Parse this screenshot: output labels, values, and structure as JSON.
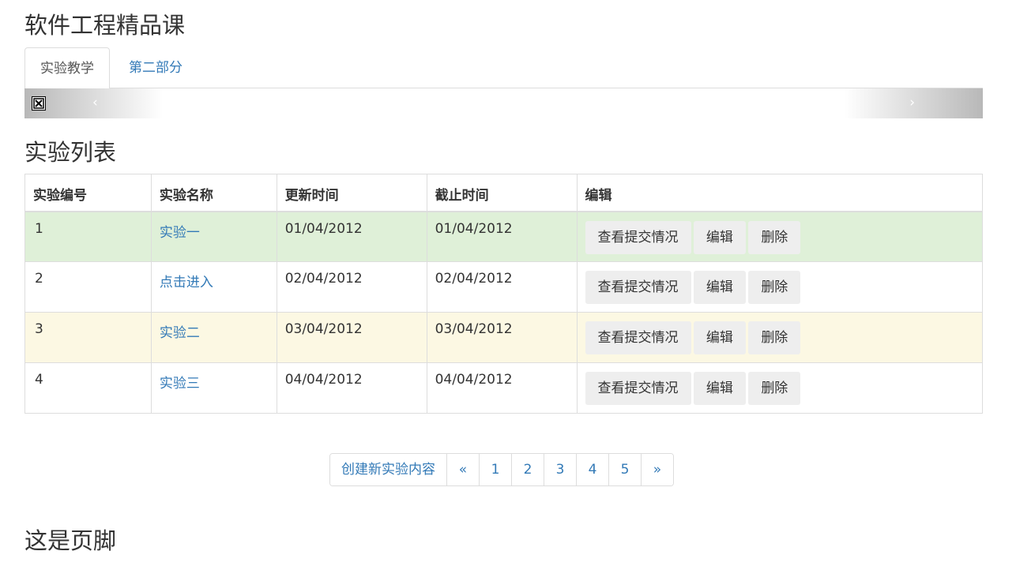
{
  "header": {
    "title": "软件工程精品课"
  },
  "tabs": [
    {
      "label": "实验教学",
      "active": true
    },
    {
      "label": "第二部分",
      "active": false
    }
  ],
  "carousel": {
    "prev_label": "‹",
    "next_label": "›",
    "image_icon": "broken-image-icon"
  },
  "section": {
    "title": "实验列表"
  },
  "table": {
    "columns": [
      "实验编号",
      "实验名称",
      "更新时间",
      "截止时间",
      "编辑"
    ],
    "rows": [
      {
        "id": "1",
        "name": "实验一",
        "updated": "01/04/2012",
        "deadline": "01/04/2012",
        "status": "success"
      },
      {
        "id": "2",
        "name": "点击进入",
        "updated": "02/04/2012",
        "deadline": "02/04/2012",
        "status": ""
      },
      {
        "id": "3",
        "name": "实验二",
        "updated": "03/04/2012",
        "deadline": "03/04/2012",
        "status": "warning"
      },
      {
        "id": "4",
        "name": "实验三",
        "updated": "04/04/2012",
        "deadline": "04/04/2012",
        "status": ""
      }
    ],
    "actions": {
      "view": "查看提交情况",
      "edit": "编辑",
      "delete": "删除"
    }
  },
  "pagination": {
    "create_label": "创建新实验内容",
    "prev": "«",
    "pages": [
      "1",
      "2",
      "3",
      "4",
      "5"
    ],
    "next": "»"
  },
  "footer": {
    "title": "这是页脚"
  },
  "colors": {
    "link": "#337ab7",
    "success_row": "#dff0d8",
    "warning_row": "#fcf8e3",
    "button_bg": "#eeeeee",
    "border": "#dddddd"
  }
}
